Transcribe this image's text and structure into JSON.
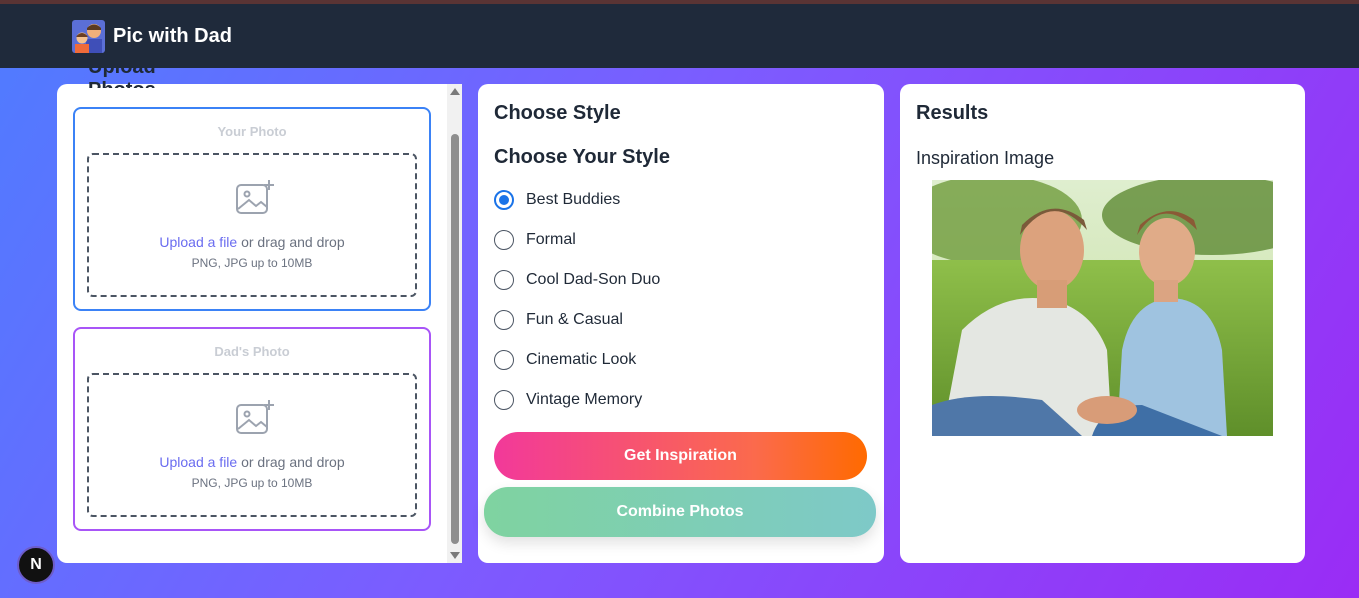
{
  "header": {
    "app_title": "Pic with Dad",
    "logo_icon": "dad-son-avatar-icon"
  },
  "upload_panel": {
    "partial_heading": "Upload Photos",
    "your_photo": {
      "title": "Your Photo",
      "upload_link": "Upload a file",
      "upload_suffix": " or drag and drop",
      "hint": "PNG, JPG up to 10MB",
      "border_color": "#3b82f6"
    },
    "dads_photo": {
      "title": "Dad's Photo",
      "upload_link": "Upload a file",
      "upload_suffix": " or drag and drop",
      "hint": "PNG, JPG up to 10MB",
      "border_color": "#a855f7"
    }
  },
  "style_panel": {
    "title": "Choose Style",
    "subtitle": "Choose Your Style",
    "options": [
      {
        "label": "Best Buddies",
        "selected": true
      },
      {
        "label": "Formal",
        "selected": false
      },
      {
        "label": "Cool Dad-Son Duo",
        "selected": false
      },
      {
        "label": "Fun & Casual",
        "selected": false
      },
      {
        "label": "Cinematic Look",
        "selected": false
      },
      {
        "label": "Vintage Memory",
        "selected": false
      }
    ],
    "inspire_button": "Get Inspiration",
    "combine_button": "Combine Photos"
  },
  "results_panel": {
    "title": "Results",
    "subtitle": "Inspiration Image"
  },
  "dev_badge": {
    "label": "N"
  },
  "colors": {
    "header_bg": "#1f2a3b",
    "accent_blue": "#1a73e8",
    "inspire_gradient": [
      "#f2399a",
      "#ff6a00"
    ],
    "combine_gradient": [
      "#7fd3a0",
      "#7ec9c8"
    ]
  }
}
